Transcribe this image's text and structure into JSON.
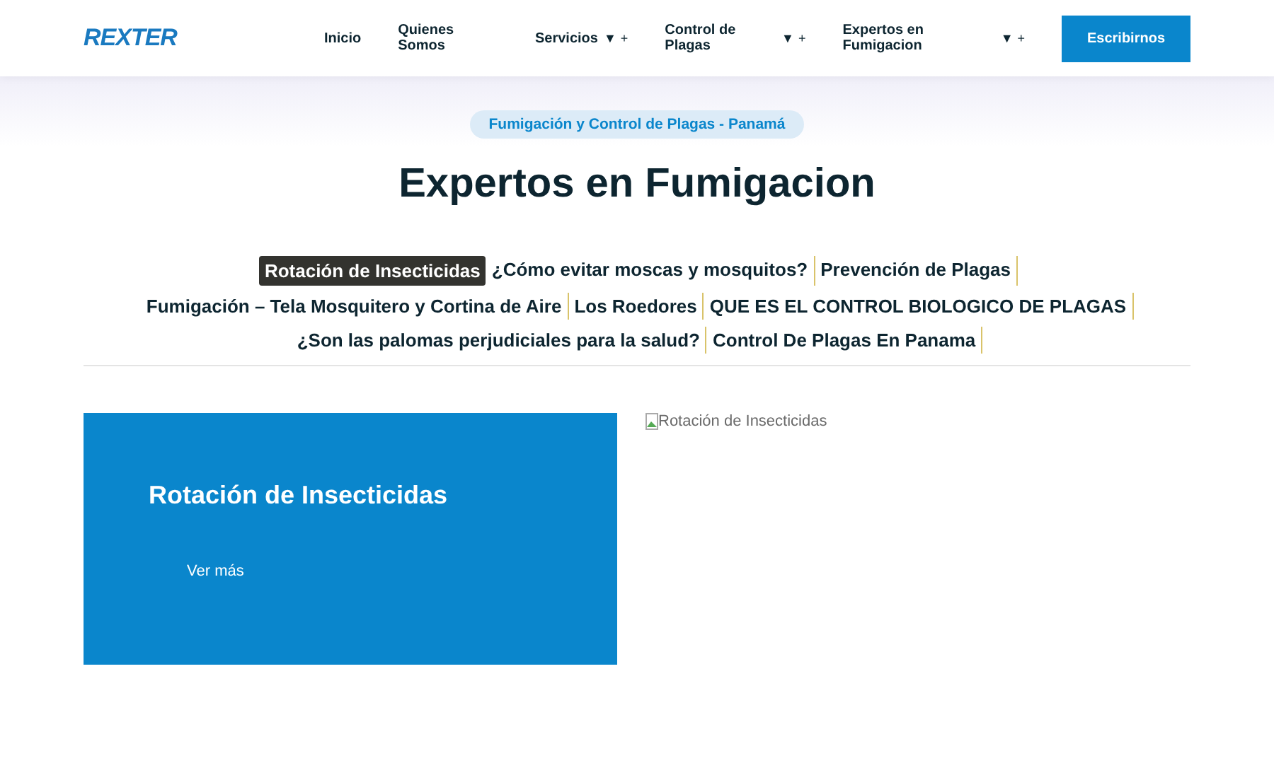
{
  "header": {
    "logo": "REXTER",
    "nav": [
      {
        "label": "Inicio"
      },
      {
        "label": "Quienes Somos"
      },
      {
        "label": "Servicios",
        "caret": "▼",
        "expander": "+"
      },
      {
        "label": "Control de Plagas",
        "caret": "▼",
        "expander": "+"
      },
      {
        "label": "Expertos en Fumigacion",
        "caret": "▼",
        "expander": "+"
      }
    ],
    "cta": "Escribirnos"
  },
  "badge": "Fumigación y Control de Plagas - Panamá",
  "title": "Expertos en Fumigacion",
  "tab_rows": [
    [
      {
        "label": "Rotación de Insecticidas",
        "selected": true
      },
      {
        "label": "¿Cómo evitar moscas y mosquitos?",
        "selected": false
      },
      {
        "label": "Prevención de Plagas",
        "selected": false
      }
    ],
    [
      {
        "label": "Fumigación – Tela Mosquitero y Cortina de Aire",
        "selected": false
      },
      {
        "label": "Los Roedores",
        "selected": false
      },
      {
        "label": "QUE ES EL CONTROL BIOLOGICO DE PLAGAS",
        "selected": false
      }
    ],
    [
      {
        "label": "¿Son las palomas perjudiciales para la salud?",
        "selected": false
      },
      {
        "label": "Control De Plagas En Panama",
        "selected": false
      }
    ]
  ],
  "panel": {
    "heading": "Rotación de Insecticidas",
    "link": "Ver más",
    "image_alt": "Rotación de Insecticidas"
  }
}
